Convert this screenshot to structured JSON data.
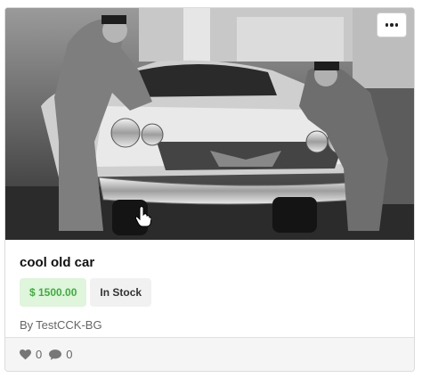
{
  "card": {
    "title": "cool old car",
    "price": "$ 1500.00",
    "stock_status": "In Stock",
    "author_prefix": "By",
    "author": "TestCCK-BG",
    "likes": "0",
    "comments": "0"
  },
  "icons": {
    "menu": "more-dots-icon",
    "likes": "heart-icon",
    "comments": "comment-icon"
  },
  "colors": {
    "price_bg": "#dff5dc",
    "price_text": "#3cae3c",
    "stock_bg": "#f1f1f1",
    "footer_bg": "#f5f5f5"
  }
}
